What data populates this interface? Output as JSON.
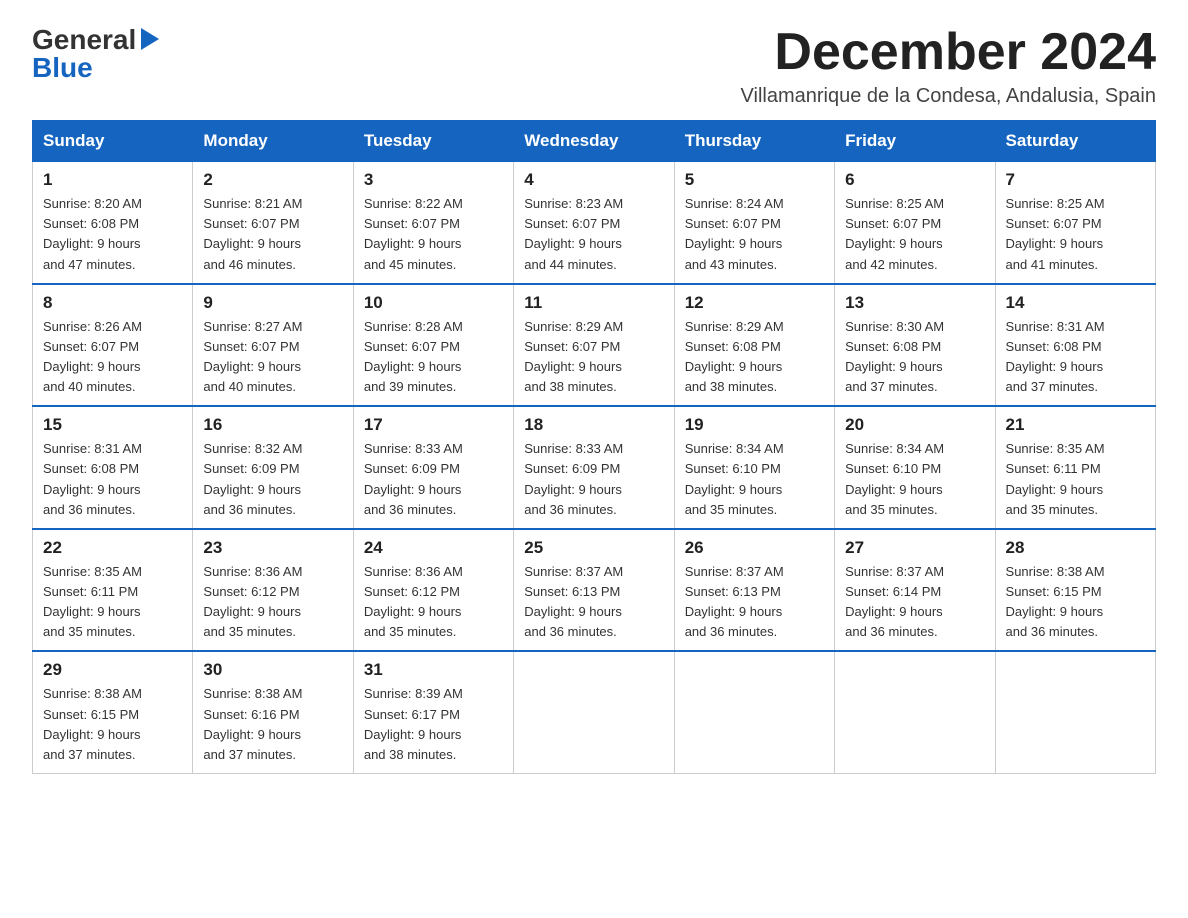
{
  "header": {
    "logo_general": "General",
    "logo_blue": "Blue",
    "month_title": "December 2024",
    "location": "Villamanrique de la Condesa, Andalusia, Spain"
  },
  "days_of_week": [
    "Sunday",
    "Monday",
    "Tuesday",
    "Wednesday",
    "Thursday",
    "Friday",
    "Saturday"
  ],
  "weeks": [
    [
      {
        "day": "1",
        "sunrise": "8:20 AM",
        "sunset": "6:08 PM",
        "daylight_hours": "9",
        "daylight_minutes": "47"
      },
      {
        "day": "2",
        "sunrise": "8:21 AM",
        "sunset": "6:07 PM",
        "daylight_hours": "9",
        "daylight_minutes": "46"
      },
      {
        "day": "3",
        "sunrise": "8:22 AM",
        "sunset": "6:07 PM",
        "daylight_hours": "9",
        "daylight_minutes": "45"
      },
      {
        "day": "4",
        "sunrise": "8:23 AM",
        "sunset": "6:07 PM",
        "daylight_hours": "9",
        "daylight_minutes": "44"
      },
      {
        "day": "5",
        "sunrise": "8:24 AM",
        "sunset": "6:07 PM",
        "daylight_hours": "9",
        "daylight_minutes": "43"
      },
      {
        "day": "6",
        "sunrise": "8:25 AM",
        "sunset": "6:07 PM",
        "daylight_hours": "9",
        "daylight_minutes": "42"
      },
      {
        "day": "7",
        "sunrise": "8:25 AM",
        "sunset": "6:07 PM",
        "daylight_hours": "9",
        "daylight_minutes": "41"
      }
    ],
    [
      {
        "day": "8",
        "sunrise": "8:26 AM",
        "sunset": "6:07 PM",
        "daylight_hours": "9",
        "daylight_minutes": "40"
      },
      {
        "day": "9",
        "sunrise": "8:27 AM",
        "sunset": "6:07 PM",
        "daylight_hours": "9",
        "daylight_minutes": "40"
      },
      {
        "day": "10",
        "sunrise": "8:28 AM",
        "sunset": "6:07 PM",
        "daylight_hours": "9",
        "daylight_minutes": "39"
      },
      {
        "day": "11",
        "sunrise": "8:29 AM",
        "sunset": "6:07 PM",
        "daylight_hours": "9",
        "daylight_minutes": "38"
      },
      {
        "day": "12",
        "sunrise": "8:29 AM",
        "sunset": "6:08 PM",
        "daylight_hours": "9",
        "daylight_minutes": "38"
      },
      {
        "day": "13",
        "sunrise": "8:30 AM",
        "sunset": "6:08 PM",
        "daylight_hours": "9",
        "daylight_minutes": "37"
      },
      {
        "day": "14",
        "sunrise": "8:31 AM",
        "sunset": "6:08 PM",
        "daylight_hours": "9",
        "daylight_minutes": "37"
      }
    ],
    [
      {
        "day": "15",
        "sunrise": "8:31 AM",
        "sunset": "6:08 PM",
        "daylight_hours": "9",
        "daylight_minutes": "36"
      },
      {
        "day": "16",
        "sunrise": "8:32 AM",
        "sunset": "6:09 PM",
        "daylight_hours": "9",
        "daylight_minutes": "36"
      },
      {
        "day": "17",
        "sunrise": "8:33 AM",
        "sunset": "6:09 PM",
        "daylight_hours": "9",
        "daylight_minutes": "36"
      },
      {
        "day": "18",
        "sunrise": "8:33 AM",
        "sunset": "6:09 PM",
        "daylight_hours": "9",
        "daylight_minutes": "36"
      },
      {
        "day": "19",
        "sunrise": "8:34 AM",
        "sunset": "6:10 PM",
        "daylight_hours": "9",
        "daylight_minutes": "35"
      },
      {
        "day": "20",
        "sunrise": "8:34 AM",
        "sunset": "6:10 PM",
        "daylight_hours": "9",
        "daylight_minutes": "35"
      },
      {
        "day": "21",
        "sunrise": "8:35 AM",
        "sunset": "6:11 PM",
        "daylight_hours": "9",
        "daylight_minutes": "35"
      }
    ],
    [
      {
        "day": "22",
        "sunrise": "8:35 AM",
        "sunset": "6:11 PM",
        "daylight_hours": "9",
        "daylight_minutes": "35"
      },
      {
        "day": "23",
        "sunrise": "8:36 AM",
        "sunset": "6:12 PM",
        "daylight_hours": "9",
        "daylight_minutes": "35"
      },
      {
        "day": "24",
        "sunrise": "8:36 AM",
        "sunset": "6:12 PM",
        "daylight_hours": "9",
        "daylight_minutes": "35"
      },
      {
        "day": "25",
        "sunrise": "8:37 AM",
        "sunset": "6:13 PM",
        "daylight_hours": "9",
        "daylight_minutes": "36"
      },
      {
        "day": "26",
        "sunrise": "8:37 AM",
        "sunset": "6:13 PM",
        "daylight_hours": "9",
        "daylight_minutes": "36"
      },
      {
        "day": "27",
        "sunrise": "8:37 AM",
        "sunset": "6:14 PM",
        "daylight_hours": "9",
        "daylight_minutes": "36"
      },
      {
        "day": "28",
        "sunrise": "8:38 AM",
        "sunset": "6:15 PM",
        "daylight_hours": "9",
        "daylight_minutes": "36"
      }
    ],
    [
      {
        "day": "29",
        "sunrise": "8:38 AM",
        "sunset": "6:15 PM",
        "daylight_hours": "9",
        "daylight_minutes": "37"
      },
      {
        "day": "30",
        "sunrise": "8:38 AM",
        "sunset": "6:16 PM",
        "daylight_hours": "9",
        "daylight_minutes": "37"
      },
      {
        "day": "31",
        "sunrise": "8:39 AM",
        "sunset": "6:17 PM",
        "daylight_hours": "9",
        "daylight_minutes": "38"
      },
      null,
      null,
      null,
      null
    ]
  ],
  "colors": {
    "header_bg": "#1565c0",
    "header_text": "#ffffff",
    "border": "#cccccc",
    "text_primary": "#222222",
    "logo_blue": "#1565c0"
  }
}
